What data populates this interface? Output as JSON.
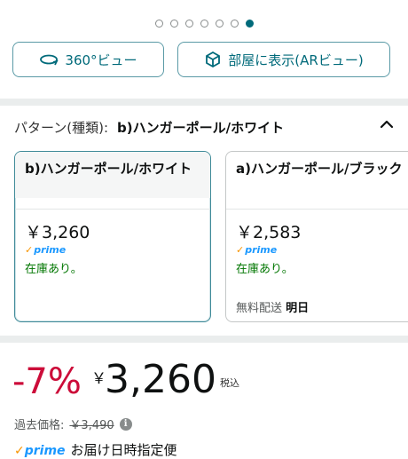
{
  "carousel": {
    "count": 7,
    "active_index": 6
  },
  "view_buttons": {
    "view_360": "360°ビュー",
    "ar_view": "部屋に表示(ARビュー)"
  },
  "variation": {
    "label": "パターン(種類):",
    "selected_value": "b)ハンガーポール/ホワイト",
    "options": [
      {
        "title": "b)ハンガーポール/ホワイト",
        "price": "￥3,260",
        "prime": "prime",
        "stock": "在庫あり。",
        "shipping_label": "",
        "shipping_day": ""
      },
      {
        "title": "a)ハンガーポール/ブラック",
        "price": "￥2,583",
        "prime": "prime",
        "stock": "在庫あり。",
        "shipping_label": "無料配送",
        "shipping_day": "明日"
      }
    ]
  },
  "price": {
    "discount": "-7%",
    "currency": "￥",
    "amount": "3,260",
    "tax_note": "税込",
    "past_label": "過去価格:",
    "past_value": "￥3,490"
  },
  "delivery": {
    "prime": "prime",
    "text": "お届け日時指定便"
  },
  "colors": {
    "accent": "#006a7a",
    "discount": "#cc0c39",
    "stock": "#007600",
    "prime_blue": "#1a98ff"
  }
}
